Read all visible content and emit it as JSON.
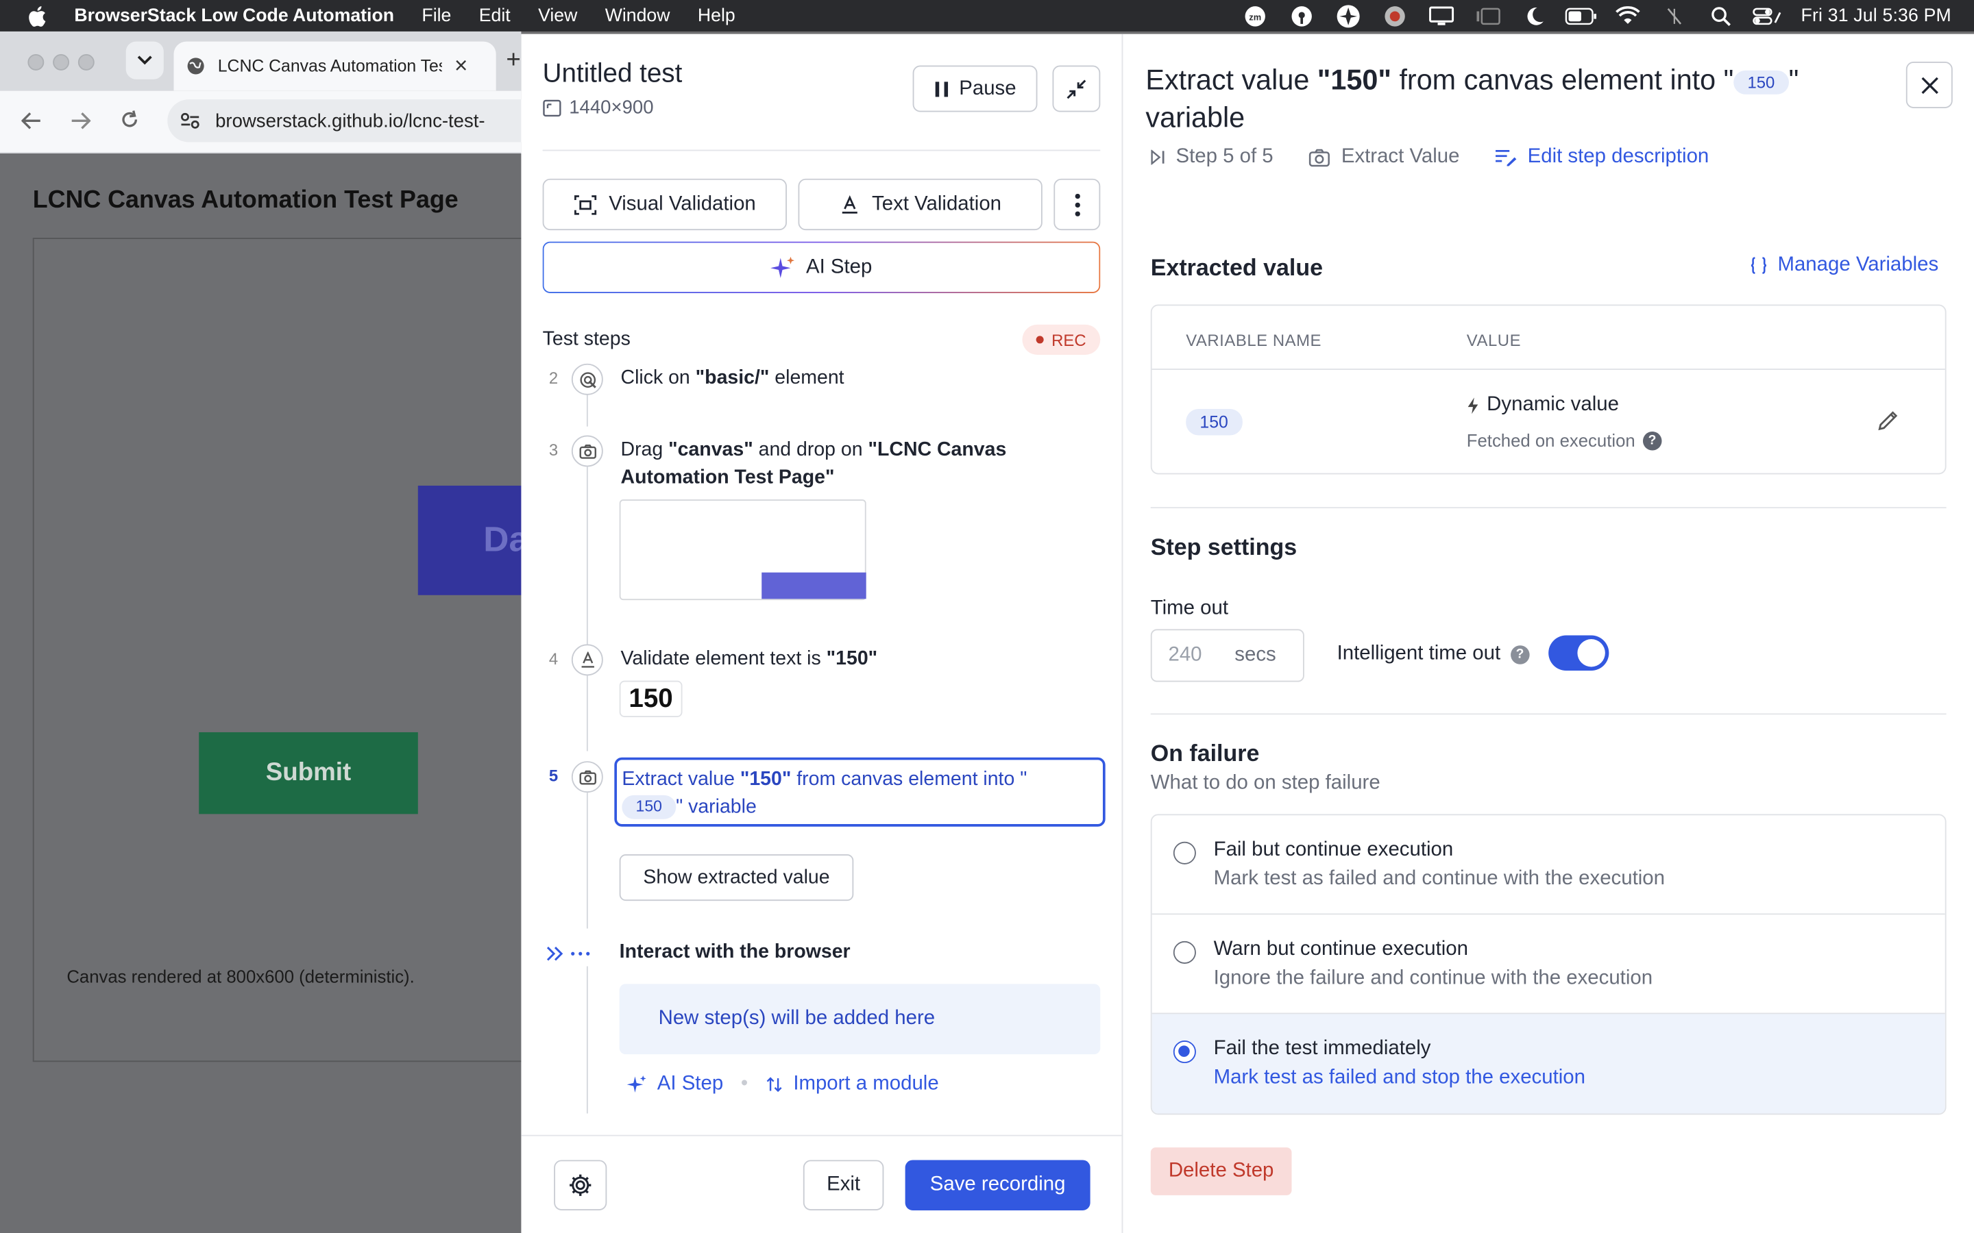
{
  "menubar": {
    "app_name": "BrowserStack Low Code Automation",
    "menus": [
      "File",
      "Edit",
      "View",
      "Window",
      "Help"
    ],
    "clock": "Fri 31 Jul  5:36 PM"
  },
  "browser": {
    "tab_title": "LCNC Canvas Automation Test Page",
    "url": "browserstack.github.io/lcnc-test-"
  },
  "page": {
    "title": "LCNC Canvas Automation Test Page",
    "blue_box_text": "Da",
    "submit_label": "Submit",
    "canvas_note": "Canvas rendered at 800x600 (deterministic)."
  },
  "recorder": {
    "title": "Untitled test",
    "resolution": "1440×900",
    "pause_label": "Pause",
    "visual_validation_label": "Visual Validation",
    "text_validation_label": "Text Validation",
    "ai_step_label": "AI Step",
    "test_steps_label": "Test steps",
    "rec_label": "REC",
    "steps": [
      {
        "num": "2",
        "prefix": "Click on ",
        "bold": "\"basic/\"",
        "suffix": " element"
      },
      {
        "num": "3",
        "prefix": "Drag ",
        "bold": "\"canvas\"",
        "middle": " and drop on ",
        "bold2": "\"LCNC Canvas Automation Test Page\""
      },
      {
        "num": "4",
        "prefix": "Validate element text is ",
        "bold": "\"150\"",
        "value": "150"
      },
      {
        "num": "5",
        "prefix": "Extract value ",
        "bold": "\"150\"",
        "middle": " from canvas element into \"",
        "chip": "150",
        "suffix": "\" variable"
      }
    ],
    "show_extracted_label": "Show extracted value",
    "interact_label": "Interact with the browser",
    "new_steps_label": "New step(s) will be added here",
    "ai_step_link": "AI Step",
    "import_module_link": "Import a module",
    "exit_label": "Exit",
    "save_label": "Save recording"
  },
  "details": {
    "heading_prefix": "Extract value ",
    "heading_bold": "\"150\"",
    "heading_middle": " from canvas element into \"",
    "heading_chip": "150",
    "heading_suffix": "\" variable",
    "step_position": "Step 5 of 5",
    "step_type": "Extract Value",
    "edit_description": "Edit step description",
    "extracted_value_title": "Extracted value",
    "manage_variables": "Manage Variables",
    "col_variable": "VARIABLE NAME",
    "col_value": "VALUE",
    "variable_name": "150",
    "dynamic_value": "Dynamic value",
    "fetched_on_execution": "Fetched on execution",
    "step_settings_title": "Step settings",
    "timeout_label": "Time out",
    "timeout_value": "240",
    "timeout_unit": "secs",
    "intelligent_timeout_label": "Intelligent time out",
    "intelligent_timeout_on": true,
    "on_failure_title": "On failure",
    "on_failure_sub": "What to do on step failure",
    "options": [
      {
        "label": "Fail but continue execution",
        "desc": "Mark test as failed and continue with the execution",
        "selected": false
      },
      {
        "label": "Warn but continue execution",
        "desc": "Ignore the failure and continue with the execution",
        "selected": false
      },
      {
        "label": "Fail the test immediately",
        "desc": "Mark test as failed and stop the execution",
        "selected": true
      }
    ],
    "delete_label": "Delete Step"
  },
  "colors": {
    "accent": "#3258e0",
    "danger": "#c0392b",
    "submit_green": "#1d6b45",
    "canvas_blue": "#33349c"
  }
}
